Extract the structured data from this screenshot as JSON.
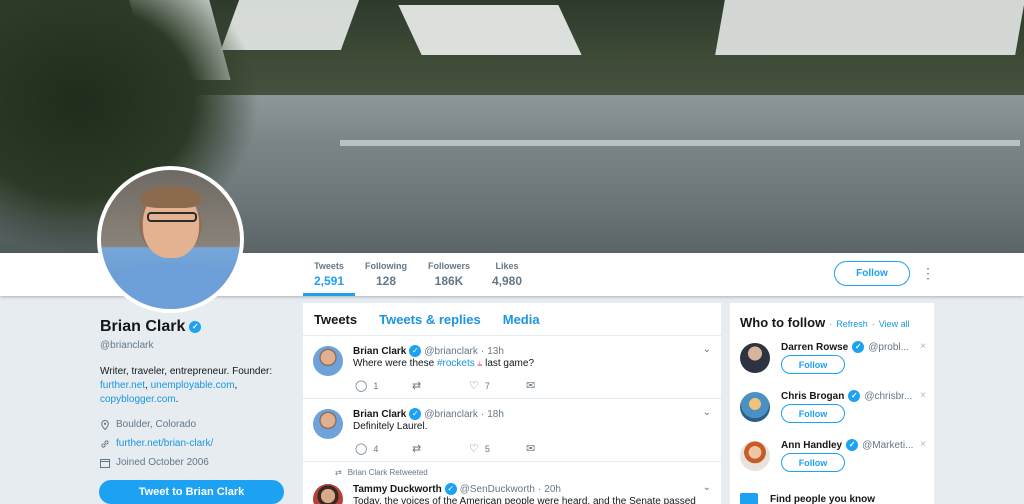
{
  "profile": {
    "name": "Brian Clark",
    "handle": "@brianclark",
    "bio_text": "Writer, traveler, entrepreneur. Founder:",
    "bio_links": [
      "further.net",
      "unemployable.com",
      "copyblogger.com"
    ],
    "location": "Boulder, Colorado",
    "website": "further.net/brian-clark/",
    "joined": "Joined October 2006",
    "tweet_to_label": "Tweet to Brian Clark"
  },
  "stats": [
    {
      "label": "Tweets",
      "value": "2,591",
      "active": true
    },
    {
      "label": "Following",
      "value": "128"
    },
    {
      "label": "Followers",
      "value": "186K"
    },
    {
      "label": "Likes",
      "value": "4,980"
    }
  ],
  "follow_label": "Follow",
  "tabs": [
    "Tweets",
    "Tweets & replies",
    "Media"
  ],
  "tweets": [
    {
      "name": "Brian Clark",
      "handle": "@brianclark",
      "time": "13h",
      "text_before": "Where were these ",
      "hashtag": "#rockets",
      "text_after": " last game?",
      "replies": "1",
      "retweets": "",
      "likes": "7"
    },
    {
      "name": "Brian Clark",
      "handle": "@brianclark",
      "time": "18h",
      "text": "Definitely Laurel.",
      "replies": "4",
      "retweets": "",
      "likes": "5"
    },
    {
      "retweeted_by": "Brian Clark Retweeted",
      "name": "Tammy Duckworth",
      "handle": "@SenDuckworth",
      "time": "20h",
      "text": "Today, the voices of the American people were heard, and the Senate passed"
    }
  ],
  "who_to_follow": {
    "title": "Who to follow",
    "refresh": "Refresh",
    "view_all": "View all",
    "suggestions": [
      {
        "name": "Darren Rowse",
        "handle": "@probl...",
        "button": "Follow"
      },
      {
        "name": "Chris Brogan",
        "handle": "@chrisbr...",
        "button": "Follow"
      },
      {
        "name": "Ann Handley",
        "handle": "@Marketi...",
        "button": "Follow"
      }
    ],
    "find_people": "Find people you know"
  },
  "colors": {
    "accent": "#1da1f2",
    "link": "#1b95e0",
    "background": "#e6ecf0"
  }
}
